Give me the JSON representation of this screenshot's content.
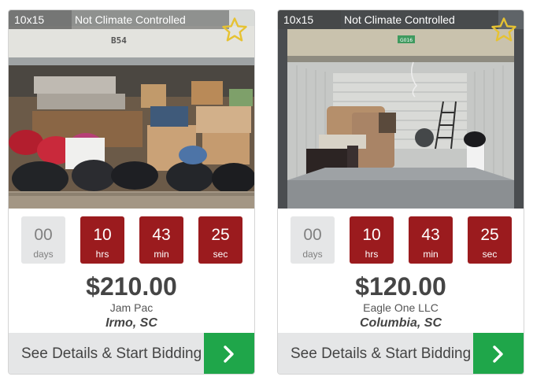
{
  "listings": [
    {
      "size": "10x15",
      "climate": "Not Climate Controlled",
      "unit_label": "B54",
      "timer": {
        "days": "00",
        "days_label": "days",
        "hours": "10",
        "hours_label": "hrs",
        "minutes": "43",
        "minutes_label": "min",
        "seconds": "25",
        "seconds_label": "sec"
      },
      "price": "$210.00",
      "seller": "Jam Pac",
      "location": "Irmo, SC",
      "cta_label": "See Details & Start Bidding",
      "favorite": false
    },
    {
      "size": "10x15",
      "climate": "Not Climate Controlled",
      "unit_label": "G016",
      "timer": {
        "days": "00",
        "days_label": "days",
        "hours": "10",
        "hours_label": "hrs",
        "minutes": "43",
        "minutes_label": "min",
        "seconds": "25",
        "seconds_label": "sec"
      },
      "price": "$120.00",
      "seller": "Eagle One LLC",
      "location": "Columbia, SC",
      "cta_label": "See Details & Start Bidding",
      "favorite": false
    }
  ],
  "colors": {
    "timer_active": "#9b1b1e",
    "timer_inactive": "#e5e6e7",
    "cta_arrow": "#1fa64a",
    "star": "#e6c232"
  },
  "icons": {
    "favorite": "star-outline-icon",
    "cta": "chevron-right-icon"
  }
}
